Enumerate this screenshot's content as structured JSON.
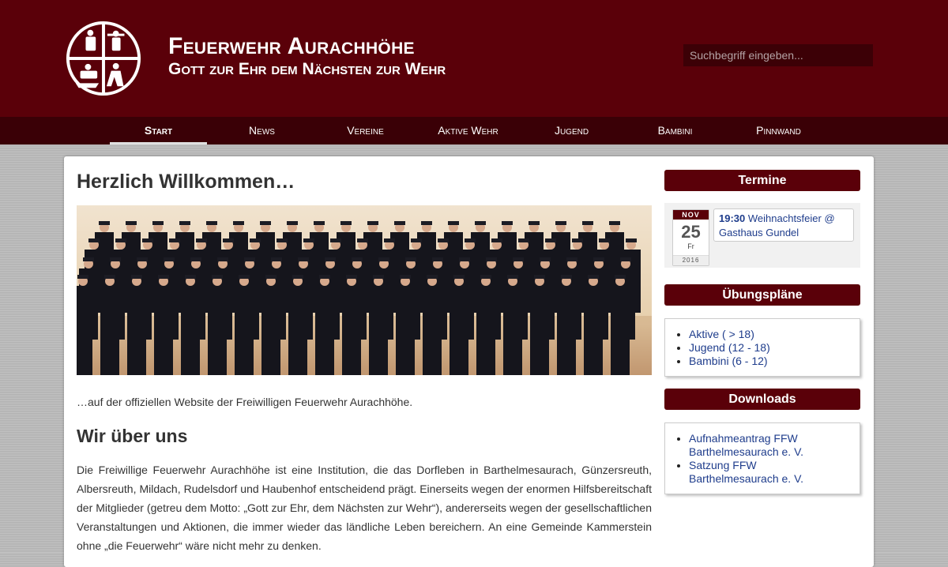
{
  "header": {
    "title": "Feuerwehr Aurachhöhe",
    "subtitle": "Gott zur Ehr dem Nächsten zur Wehr",
    "search_placeholder": "Suchbegriff eingeben..."
  },
  "nav": {
    "items": [
      {
        "label": "Start",
        "active": true
      },
      {
        "label": "News"
      },
      {
        "label": "Vereine"
      },
      {
        "label": "Aktive Wehr"
      },
      {
        "label": "Jugend"
      },
      {
        "label": "Bambini"
      },
      {
        "label": "Pinnwand"
      }
    ]
  },
  "main": {
    "title": "Herzlich Willkommen…",
    "intro": "…auf der offiziellen Website der Freiwilligen Feuerwehr Aurachhöhe.",
    "about_heading": "Wir über uns",
    "about_text": "Die Freiwillige Feuerwehr Aurachhöhe ist eine Institution, die das Dorfleben in Barthelmesaurach, Günzersreuth, Albersreuth, Mildach, Rudelsdorf und Haubenhof entscheidend prägt. Einerseits wegen der enormen Hilfsbereitschaft der Mitglieder (getreu dem Motto: „Gott zur Ehr, dem Nächsten zur Wehr“), andererseits wegen der gesellschaftlichen Veranstaltungen und Aktionen, die immer wieder das ländliche Leben bereichern. An eine Gemeinde Kammerstein ohne „die Feuerwehr“ wäre nicht mehr zu denken."
  },
  "sidebar": {
    "termine": {
      "heading": "Termine",
      "event": {
        "month": "NOV",
        "day": "25",
        "weekday": "Fr",
        "year": "2016",
        "time": "19:30",
        "title": "Weihnachtsfeier @ Gasthaus Gundel"
      }
    },
    "uebungsplaene": {
      "heading": "Übungspläne",
      "items": [
        "Aktive ( > 18)",
        "Jugend (12 - 18)",
        "Bambini (6 - 12)"
      ]
    },
    "downloads": {
      "heading": "Downloads",
      "items": [
        "Aufnahmeantrag FFW Barthelmesaurach e. V.",
        "Satzung FFW Barthelmesaurach e. V."
      ]
    }
  },
  "colors": {
    "brand": "#5a0009",
    "nav_bg": "#3a0006",
    "link": "#1f3d8c"
  }
}
